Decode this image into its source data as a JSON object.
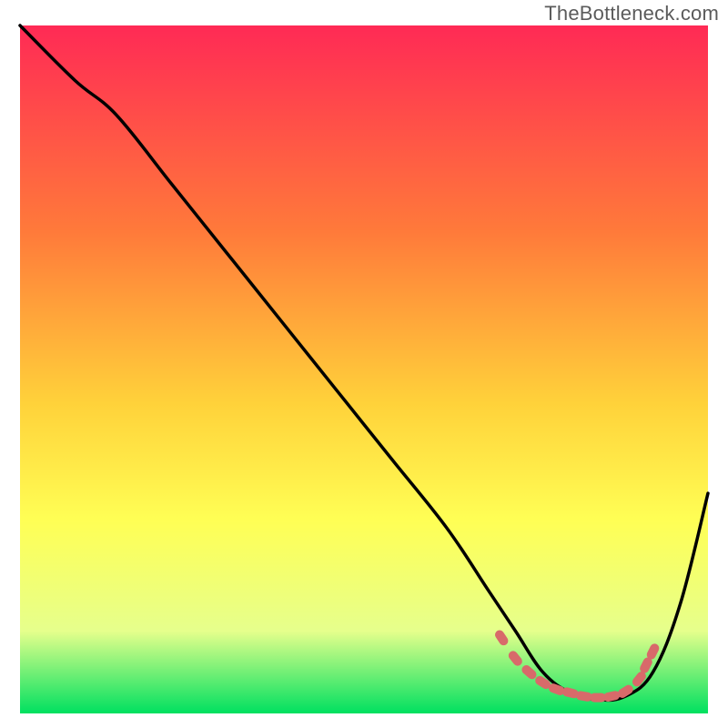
{
  "watermark": "TheBottleneck.com",
  "colors": {
    "gradient_top": "#ff2a55",
    "gradient_mid_a": "#ff7a3a",
    "gradient_mid_b": "#ffd23a",
    "gradient_mid_c": "#ffff55",
    "gradient_mid_d": "#e6ff8c",
    "gradient_bottom": "#00e060",
    "curve_stroke": "#000000",
    "markers_fill": "#d86a6a"
  },
  "chart_data": {
    "type": "line",
    "title": "",
    "xlabel": "",
    "ylabel": "",
    "xlim": [
      0,
      100
    ],
    "ylim": [
      0,
      100
    ],
    "series": [
      {
        "name": "bottleneck-curve",
        "x": [
          0,
          8,
          14,
          22,
          30,
          38,
          46,
          54,
          62,
          68,
          72,
          76,
          80,
          84,
          88,
          92,
          96,
          100
        ],
        "y": [
          100,
          92,
          87,
          77,
          67,
          57,
          47,
          37,
          27,
          18,
          12,
          6,
          3,
          2,
          2.5,
          6,
          16,
          32
        ]
      }
    ],
    "markers": {
      "name": "marker-points",
      "x": [
        70,
        72,
        74,
        76,
        78,
        80,
        82,
        84,
        86,
        88,
        90,
        91,
        92
      ],
      "y": [
        11,
        8,
        6,
        4.5,
        3.5,
        3,
        2.5,
        2.3,
        2.5,
        3.2,
        5,
        7,
        9
      ]
    }
  }
}
